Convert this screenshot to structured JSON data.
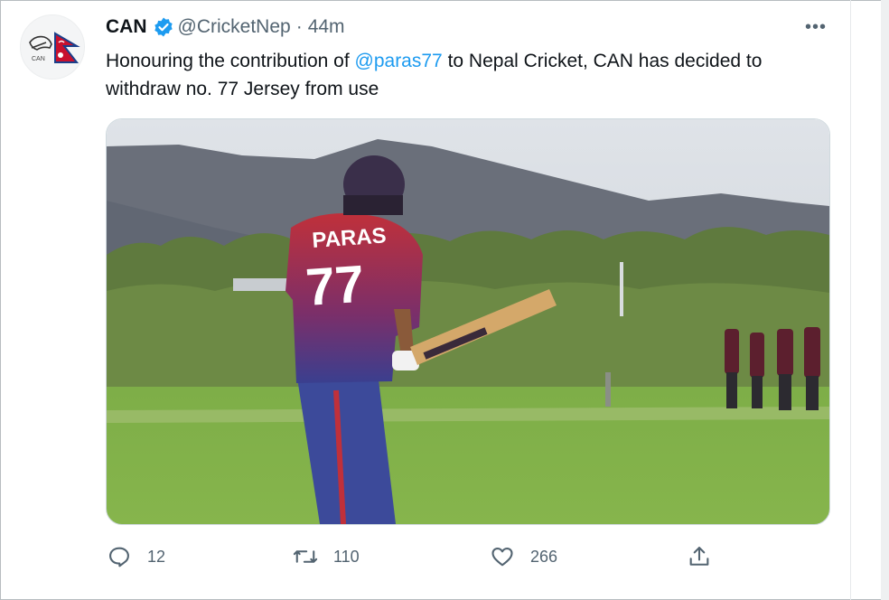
{
  "tweet": {
    "display_name": "CAN",
    "handle": "@CricketNep",
    "separator": "·",
    "time": "44m",
    "more_label": "•••",
    "text_before": "Honouring the contribution of ",
    "mention": "@paras77",
    "text_after": " to Nepal Cricket, CAN has decided to withdraw no. 77 Jersey from use",
    "avatar_logo_text": "CAN",
    "media": {
      "jersey_name": "PARAS",
      "jersey_number": "77"
    },
    "actions": {
      "reply_count": "12",
      "retweet_count": "110",
      "like_count": "266"
    }
  },
  "icons": {
    "verified": "verified-badge-icon",
    "more": "more-horizontal-icon",
    "reply": "reply-icon",
    "retweet": "retweet-icon",
    "like": "heart-icon",
    "share": "share-icon"
  },
  "colors": {
    "accent": "#1d9bf0",
    "text_primary": "#0f1419",
    "text_secondary": "#536471"
  }
}
